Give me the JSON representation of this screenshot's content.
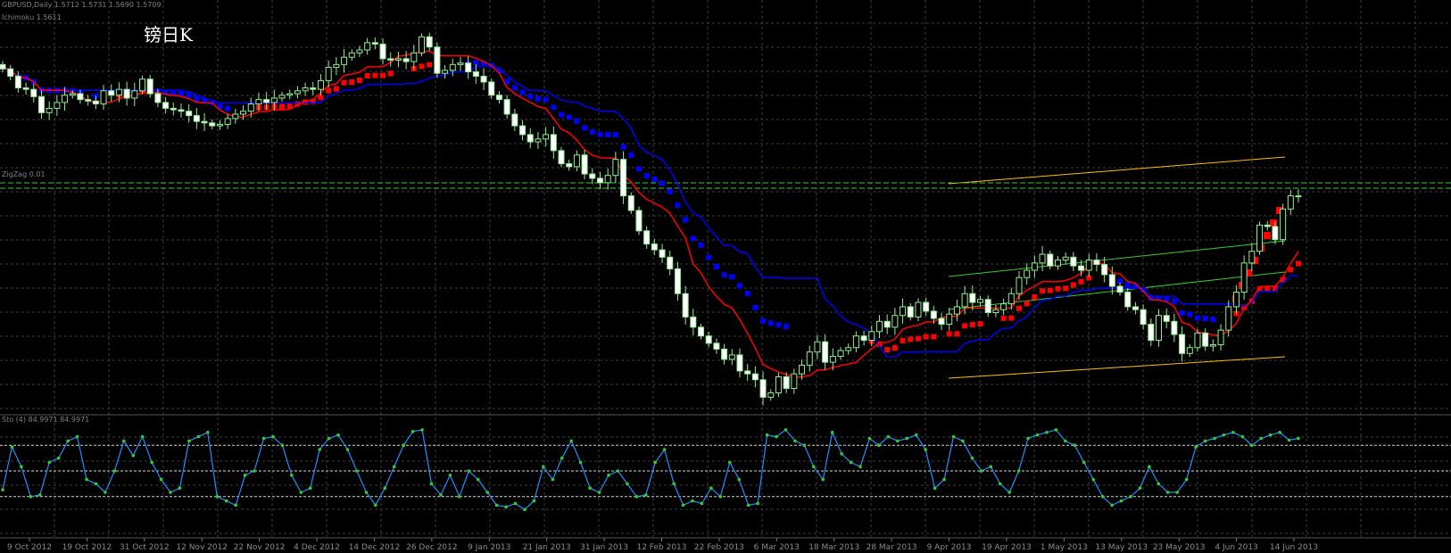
{
  "header": {
    "symbol_info": "GBPUSD,Daily  1.5712 1.5731 1.5690 1.5709",
    "indicator_line": "Ichimoku 1.5611",
    "level_label": "ZigZag 0.01",
    "title": "镑日K",
    "stoch_label": "Sto (4) 84.9971 84.9971"
  },
  "colors": {
    "background": "#000000",
    "grid": "#3b3b3b",
    "candle": "#90ee90",
    "tenkan": "#ff0000",
    "kijun": "#0000ff",
    "kumo_a": "#ff0000",
    "kumo_b": "#0000ff",
    "channel_outer": "#ffbf00",
    "channel_inner": "#32cd32",
    "level": "#32cd32",
    "stochastic_line": "#1e90ff",
    "stochastic_points": "#32cd32",
    "stochastic_levels": "#d3d3d3"
  },
  "chart_data": [
    {
      "type": "candlestick",
      "title": "镑日K",
      "xlabel": "",
      "ylabel": "",
      "grid": true,
      "x_ticks": [
        "9 Oct 2012",
        "19 Oct 2012",
        "31 Oct 2012",
        "12 Nov 2012",
        "22 Nov 2012",
        "4 Dec 2012",
        "14 Dec 2012",
        "26 Dec 2012",
        "9 Jan 2013",
        "21 Jan 2013",
        "31 Jan 2013",
        "12 Feb 2013",
        "22 Feb 2013",
        "6 Mar 2013",
        "18 Mar 2013",
        "28 Mar 2013",
        "9 Apr 2013",
        "19 Apr 2013",
        "1 May 2013",
        "13 May 2013",
        "23 May 2013",
        "4 Jun 2013",
        "14 Jun 2013"
      ],
      "close": [
        1.6145,
        1.612,
        1.608,
        1.6075,
        1.605,
        1.5995,
        1.601,
        1.603,
        1.6055,
        1.606,
        1.604,
        1.6035,
        1.6025,
        1.607,
        1.6055,
        1.6075,
        1.6045,
        1.607,
        1.611,
        1.606,
        1.603,
        1.601,
        1.6005,
        1.6,
        1.5985,
        1.5965,
        1.596,
        1.595,
        1.5955,
        1.5975,
        1.599,
        1.6,
        1.6025,
        1.604,
        1.603,
        1.6045,
        1.6055,
        1.606,
        1.607,
        1.608,
        1.6075,
        1.6105,
        1.615,
        1.616,
        1.6185,
        1.62,
        1.621,
        1.6235,
        1.623,
        1.618,
        1.6175,
        1.618,
        1.617,
        1.62,
        1.6255,
        1.622,
        1.613,
        1.614,
        1.616,
        1.6165,
        1.6135,
        1.612,
        1.61,
        1.6055,
        1.604,
        1.599,
        1.595,
        1.592,
        1.5895,
        1.5905,
        1.592,
        1.5865,
        1.582,
        1.581,
        1.585,
        1.5785,
        1.577,
        1.5755,
        1.578,
        1.5835,
        1.571,
        1.566,
        1.559,
        1.5545,
        1.5525,
        1.55,
        1.546,
        1.5375,
        1.5295,
        1.526,
        1.523,
        1.5205,
        1.5185,
        1.515,
        1.5165,
        1.511,
        1.51,
        1.508,
        1.502,
        1.5035,
        1.509,
        1.505,
        1.51,
        1.513,
        1.5175,
        1.521,
        1.514,
        1.516,
        1.518,
        1.519,
        1.523,
        1.5215,
        1.5245,
        1.528,
        1.526,
        1.53,
        1.533,
        1.5295,
        1.5345,
        1.5315,
        1.529,
        1.527,
        1.5305,
        1.533,
        1.5375,
        1.5345,
        1.5355,
        1.531,
        1.532,
        1.534,
        1.5375,
        1.543,
        1.5455,
        1.548,
        1.551,
        1.547,
        1.549,
        1.55,
        1.547,
        1.5455,
        1.549,
        1.5475,
        1.544,
        1.54,
        1.538,
        1.533,
        1.532,
        1.527,
        1.5215,
        1.53,
        1.528,
        1.5235,
        1.517,
        1.519,
        1.524,
        1.5195,
        1.52,
        1.525,
        1.533,
        1.538,
        1.548,
        1.552,
        1.561,
        1.5605,
        1.556,
        1.5665,
        1.571,
        1.5709
      ],
      "stochastic": {
        "levels": [
          80,
          50,
          20
        ],
        "values": [
          28,
          78,
          55,
          20,
          22,
          60,
          65,
          85,
          90,
          40,
          35,
          25,
          50,
          85,
          68,
          90,
          60,
          40,
          25,
          30,
          85,
          90,
          95,
          20,
          15,
          10,
          45,
          50,
          88,
          90,
          80,
          45,
          25,
          30,
          75,
          88,
          92,
          75,
          50,
          25,
          10,
          30,
          55,
          80,
          96,
          98,
          35,
          22,
          45,
          20,
          50,
          40,
          25,
          10,
          8,
          12,
          5,
          15,
          55,
          40,
          65,
          85,
          60,
          30,
          25,
          45,
          50,
          35,
          20,
          22,
          60,
          75,
          35,
          10,
          15,
          12,
          30,
          20,
          60,
          40,
          10,
          12,
          92,
          90,
          98,
          85,
          80,
          55,
          40,
          95,
          70,
          60,
          55,
          88,
          80,
          90,
          85,
          88,
          92,
          75,
          30,
          40,
          90,
          85,
          65,
          50,
          55,
          35,
          25,
          50,
          88,
          92,
          95,
          98,
          85,
          80,
          60,
          40,
          20,
          10,
          15,
          20,
          30,
          55,
          35,
          25,
          25,
          40,
          78,
          85,
          88,
          92,
          95,
          90,
          80,
          88,
          92,
          95,
          86,
          88
        ]
      }
    }
  ]
}
